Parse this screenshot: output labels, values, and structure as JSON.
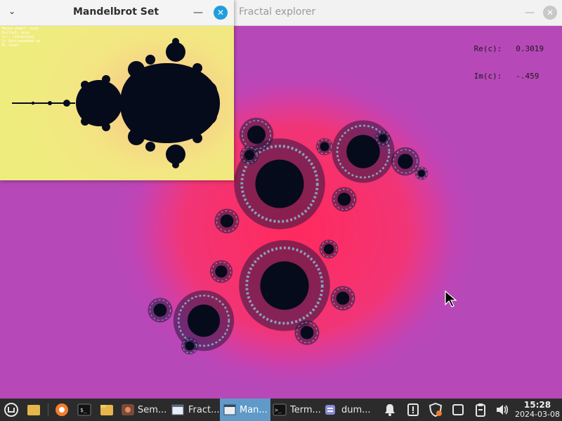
{
  "fractal_window": {
    "title": "Fractal explorer",
    "minimize_glyph": "—",
    "close_glyph": "✕",
    "readout": {
      "re_label": "Re(c):",
      "re_value": "0.3019",
      "im_label": "Im(c):",
      "im_value": "-.459"
    }
  },
  "mandelbrot_window": {
    "title": "Mandelbrot Set",
    "menu_glyph": "⌄",
    "minimize_glyph": "—",
    "close_glyph": "✕",
    "help_lines": [
      "Mouse wheel: zoom",
      "Button1: move",
      "+/-: iterations",
      "1) Dattrayedand up",
      "R: reset"
    ]
  },
  "taskbar": {
    "items": [
      {
        "name": "mint-menu-icon",
        "label": ""
      },
      {
        "name": "show-desktop-icon",
        "label": ""
      },
      {
        "name": "firefox-icon",
        "label": ""
      },
      {
        "name": "terminal-launcher-icon",
        "label": ""
      },
      {
        "name": "files-launcher-icon",
        "label": ""
      },
      {
        "name": "task-semin",
        "label": "Sem..."
      },
      {
        "name": "task-fractal-explorer",
        "label": "Fract..."
      },
      {
        "name": "task-mandelbrot",
        "label": "Man..."
      },
      {
        "name": "task-terminal",
        "label": "Term..."
      },
      {
        "name": "task-dummy",
        "label": "dum..."
      }
    ],
    "tray": [
      "notifications-icon",
      "update-manager-icon",
      "shield-icon",
      "window-icon",
      "clipboard-icon",
      "volume-icon"
    ],
    "clock_time": "15:28",
    "clock_date": "2024-03-08"
  },
  "colors": {
    "fractal_bg": "#b748b8",
    "julia_core": "#060b1c",
    "julia_glow": "#ff2c6c",
    "mandel_bg": "#f0ec80",
    "taskbar_bg": "#2b2b2b",
    "active_task": "#5f9ac8",
    "close_accent": "#1f9ede"
  }
}
